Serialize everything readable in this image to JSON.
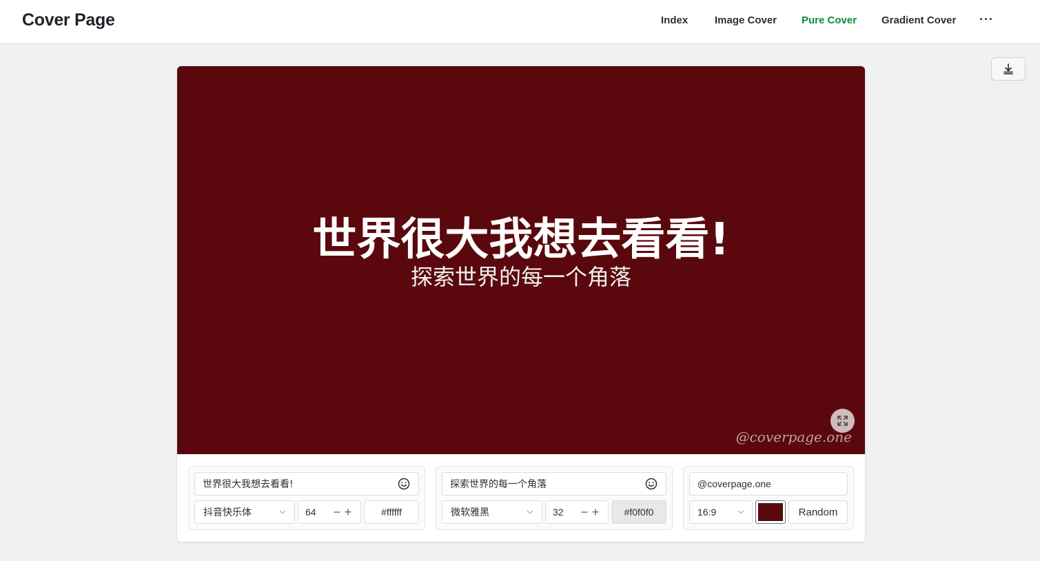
{
  "app": {
    "title": "Cover Page"
  },
  "nav": {
    "items": [
      {
        "label": "Index",
        "active": false
      },
      {
        "label": "Image Cover",
        "active": false
      },
      {
        "label": "Pure Cover",
        "active": true
      },
      {
        "label": "Gradient Cover",
        "active": false
      }
    ],
    "more_label": "···"
  },
  "toolbar": {
    "download_icon": "download-icon"
  },
  "cover": {
    "background": "#5a080e",
    "title": {
      "text": "世界很大我想去看看!",
      "size": "64",
      "color": "#ffffff"
    },
    "subtitle": {
      "text": "探索世界的每一个角落",
      "size": "32",
      "color": "#f0f0f0"
    },
    "watermark": "@coverpage.one",
    "fullscreen_icon": "fullscreen-icon"
  },
  "controls": {
    "title": {
      "text": "世界很大我想去看看!",
      "font": "抖音快乐体",
      "size": "64",
      "color": "#ffffff",
      "emoji_icon": "emoji-icon"
    },
    "subtitle": {
      "text": "探索世界的每一个角落",
      "font": "微软雅黑",
      "size": "32",
      "color": "#f0f0f0",
      "emoji_icon": "emoji-icon"
    },
    "settings": {
      "watermark": "@coverpage.one",
      "ratio": "16:9",
      "bg_color": "#5a080e",
      "random_label": "Random"
    }
  },
  "colors": {
    "accent": "#0b8a3e",
    "page_bg": "#f0f1f3"
  }
}
